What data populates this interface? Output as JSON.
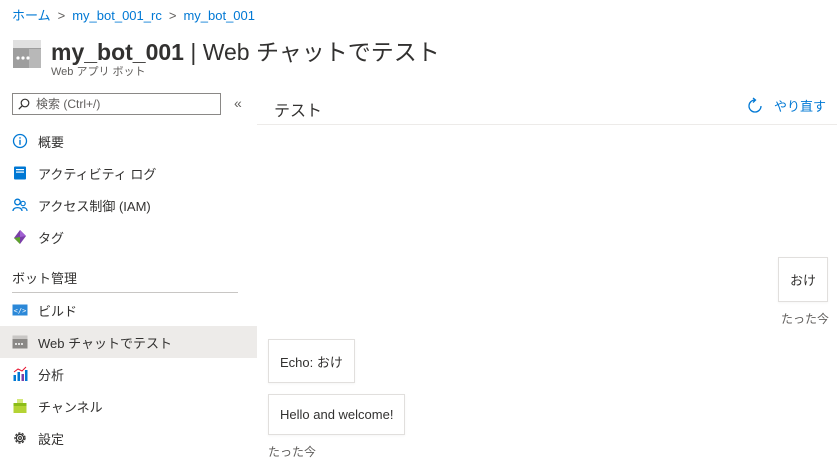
{
  "breadcrumb": {
    "items": [
      "ホーム",
      "my_bot_001_rc",
      "my_bot_001"
    ],
    "separator": ">"
  },
  "header": {
    "title_bold": "my_bot_001",
    "title_rest": " | Web チャットでテスト",
    "subtitle": "Web アプリ ボット"
  },
  "sidebar": {
    "search_placeholder": "検索 (Ctrl+/)",
    "collapse_label": "«",
    "items": [
      {
        "label": "概要",
        "icon": "info-icon"
      },
      {
        "label": "アクティビティ ログ",
        "icon": "activity-log-icon"
      },
      {
        "label": "アクセス制御 (IAM)",
        "icon": "people-icon"
      },
      {
        "label": "タグ",
        "icon": "tag-icon"
      }
    ],
    "section_title": "ボット管理",
    "bot_items": [
      {
        "label": "ビルド",
        "icon": "code-icon"
      },
      {
        "label": "Web チャットでテスト",
        "icon": "webchat-icon",
        "active": true
      },
      {
        "label": "分析",
        "icon": "analytics-icon"
      },
      {
        "label": "チャンネル",
        "icon": "channels-icon"
      },
      {
        "label": "設定",
        "icon": "gear-icon"
      }
    ]
  },
  "main": {
    "title": "テスト",
    "retry_label": "やり直す",
    "messages": [
      {
        "from": "user",
        "text": "おけ",
        "timestamp": "たった今"
      },
      {
        "from": "bot",
        "text": "Echo: おけ"
      },
      {
        "from": "bot",
        "text": "Hello and welcome!",
        "timestamp": "たった今"
      }
    ]
  },
  "colors": {
    "accent": "#0078d4",
    "active_bg": "#edebe9"
  }
}
